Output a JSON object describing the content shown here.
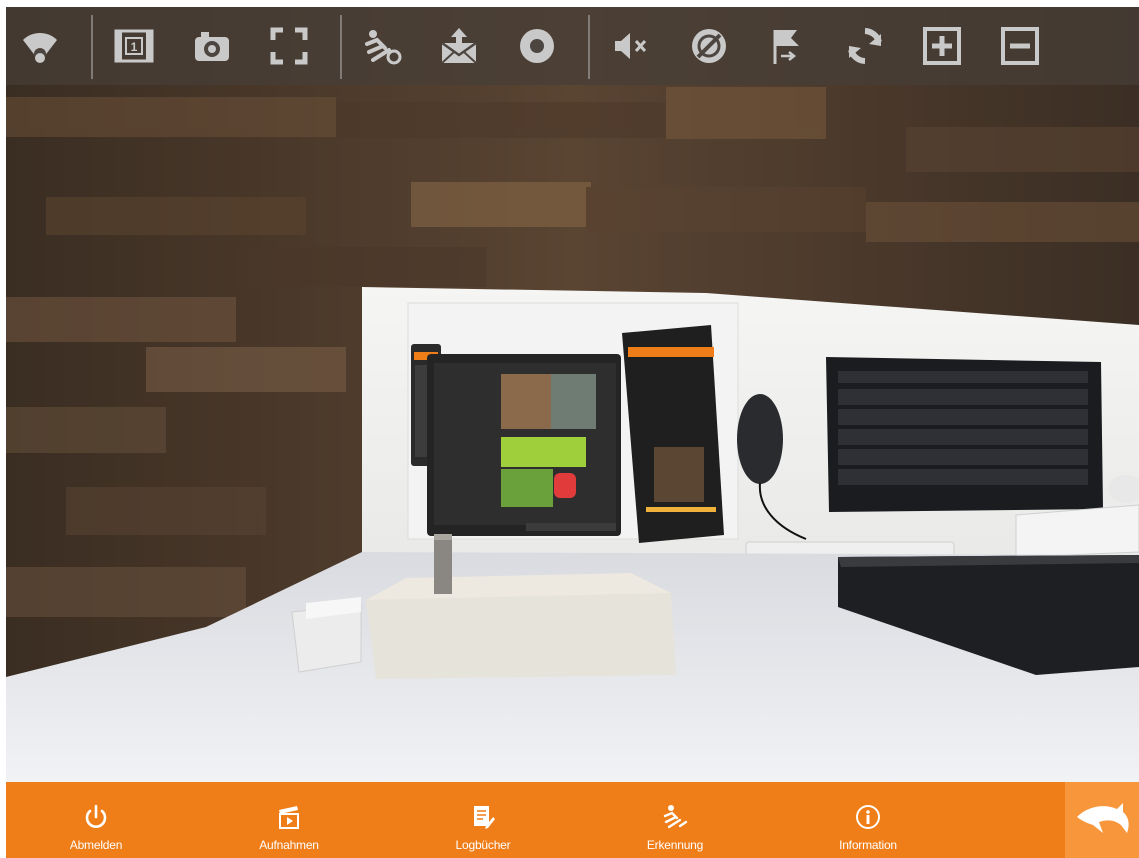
{
  "toolbar": {
    "items": [
      {
        "name": "wifi-icon",
        "kind": "status"
      },
      {
        "name": "film-channel-icon",
        "kind": "button",
        "text": "1"
      },
      {
        "name": "camera-snapshot-icon",
        "kind": "button"
      },
      {
        "name": "fullscreen-icon",
        "kind": "button"
      },
      {
        "name": "motion-detection-icon",
        "kind": "button"
      },
      {
        "name": "mail-upload-icon",
        "kind": "button"
      },
      {
        "name": "record-icon",
        "kind": "button"
      },
      {
        "name": "mute-icon",
        "kind": "button"
      },
      {
        "name": "privacy-off-icon",
        "kind": "button"
      },
      {
        "name": "flag-route-icon",
        "kind": "button"
      },
      {
        "name": "refresh-icon",
        "kind": "button"
      },
      {
        "name": "zoom-in-icon",
        "kind": "button"
      },
      {
        "name": "zoom-out-icon",
        "kind": "button"
      }
    ],
    "icon_color": "#c9c9c9"
  },
  "bottom_nav": {
    "items": [
      {
        "label": "Abmelden",
        "icon": "power-icon"
      },
      {
        "label": "Aufnahmen",
        "icon": "clapperboard-icon"
      },
      {
        "label": "Logbücher",
        "icon": "logbook-icon"
      },
      {
        "label": "Erkennung",
        "icon": "motion-detection-icon"
      },
      {
        "label": "Information",
        "icon": "info-icon"
      }
    ],
    "logo_icon": "dolphin-logo-icon"
  },
  "colors": {
    "accent": "#ef7d18",
    "accent_light": "#f7963a",
    "toolbar_bg": "#463e38"
  }
}
